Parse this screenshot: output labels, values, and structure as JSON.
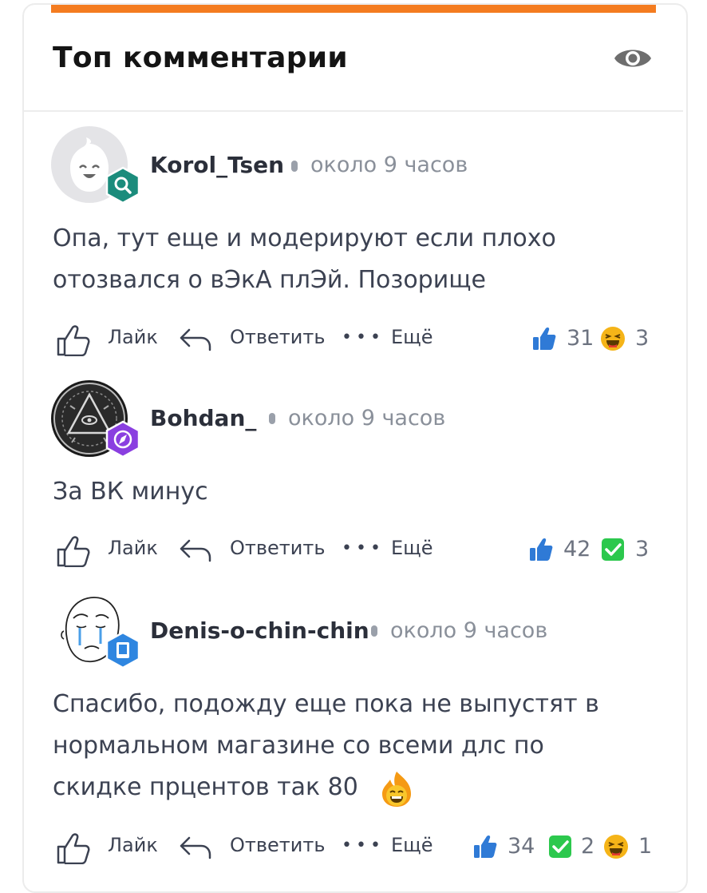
{
  "header": {
    "title": "Топ комментарии",
    "eye_icon": "eye-icon"
  },
  "colors": {
    "accent": "#f47c20",
    "like_blue": "#2f7ad6",
    "check_green": "#2cc84d",
    "laugh_yellow": "#f5b418"
  },
  "actions": {
    "like": "Лайк",
    "reply": "Ответить",
    "more": "Ещё"
  },
  "comments": [
    {
      "author": "Korol_Tsen",
      "time": "около 9 часов",
      "text_lines": [
        "Опа, тут еще и модерируют если плохо",
        "отозвался о вЭкА плЭй. Позорище"
      ],
      "reactions": [
        {
          "icon": "thumbs-up-icon",
          "count": "31"
        },
        {
          "icon": "laugh-emoji-icon",
          "count": "3"
        }
      ]
    },
    {
      "author": "Bohdan_",
      "time": "около 9 часов",
      "text_lines": [
        "За ВК минус"
      ],
      "reactions": [
        {
          "icon": "thumbs-up-icon",
          "count": "42"
        },
        {
          "icon": "check-icon",
          "count": "3"
        }
      ]
    },
    {
      "author": "Denis-o-chin-chin",
      "time": "около 9 часов",
      "text_lines": [
        "Спасибо, подожду еще пока не выпустят в",
        "нормальном магазине со всеми длс по",
        "скидке прцентов так 80"
      ],
      "inline_emoji": "fire-smile-emoji-icon",
      "reactions": [
        {
          "icon": "thumbs-up-icon",
          "count": "34"
        },
        {
          "icon": "check-icon",
          "count": "2"
        },
        {
          "icon": "laugh-emoji-icon",
          "count": "1"
        }
      ]
    }
  ]
}
